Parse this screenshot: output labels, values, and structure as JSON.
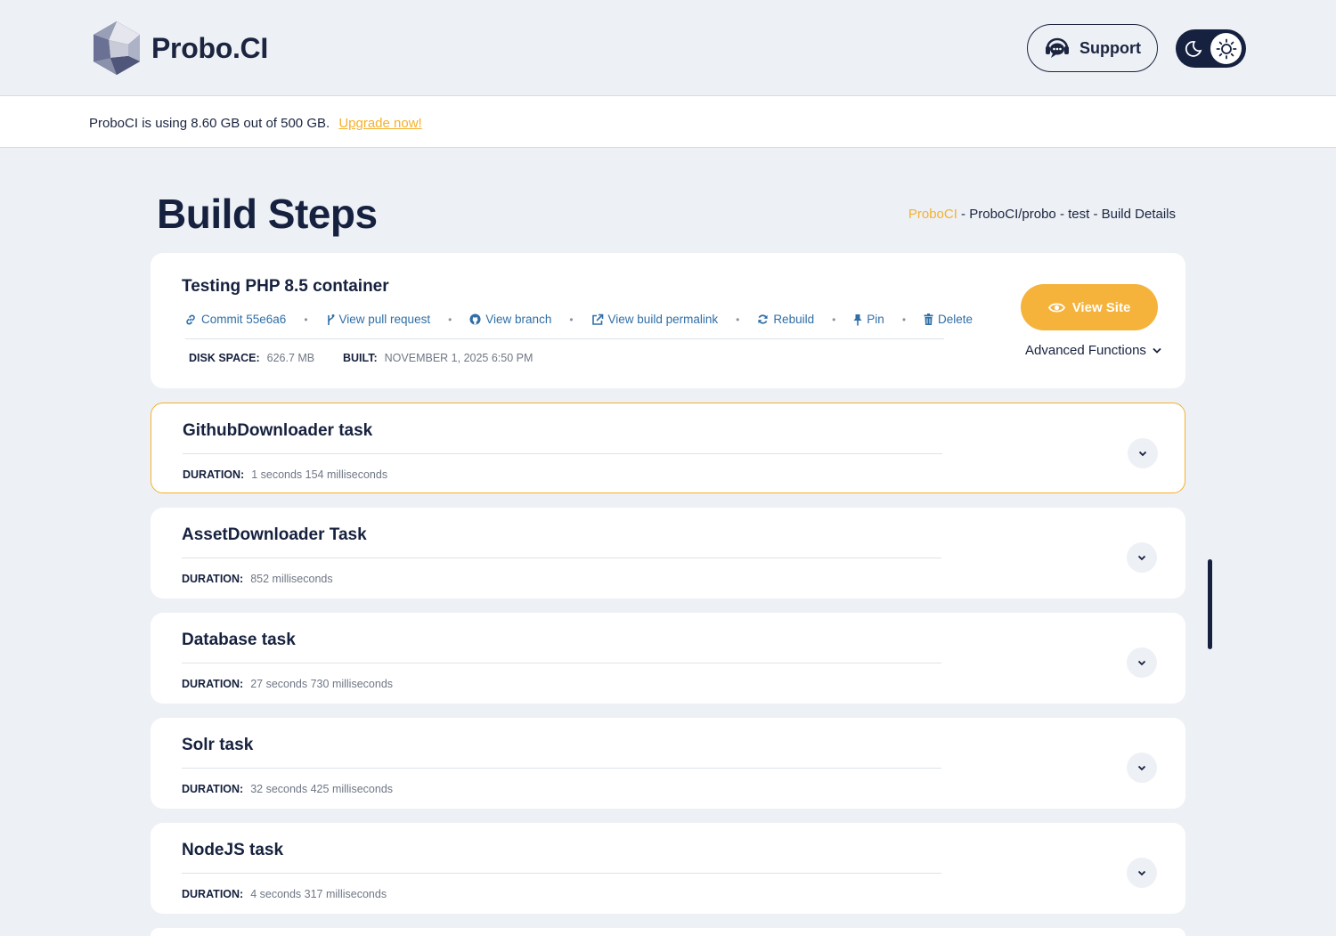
{
  "header": {
    "brand_name": "Probo.CI",
    "support_label": "Support",
    "theme_toggle": {
      "mode": "light"
    }
  },
  "storage": {
    "message": "ProboCI is using 8.60 GB out of 500 GB.",
    "upgrade_label": "Upgrade now!"
  },
  "page": {
    "title": "Build Steps",
    "breadcrumb": {
      "root": "ProboCI",
      "rest": " - ProboCI/probo - test - Build Details"
    }
  },
  "build": {
    "title": "Testing PHP 8.5 container",
    "actions": [
      {
        "label": "Commit 55e6a6",
        "icon": "link-icon"
      },
      {
        "label": "View pull request",
        "icon": "git-branch-icon"
      },
      {
        "label": "View branch",
        "icon": "github-icon"
      },
      {
        "label": "View build permalink",
        "icon": "external-link-icon"
      },
      {
        "label": "Rebuild",
        "icon": "refresh-icon"
      },
      {
        "label": "Pin",
        "icon": "pin-icon"
      },
      {
        "label": "Delete",
        "icon": "trash-icon"
      }
    ],
    "disk_space_label": "DISK SPACE:",
    "disk_space_value": "626.7 MB",
    "built_label": "BUILT:",
    "built_value": "NOVEMBER 1, 2025 6:50 PM",
    "view_site_label": "View Site",
    "advanced_label": "Advanced Functions"
  },
  "tasks": [
    {
      "name": "GithubDownloader task",
      "duration_label": "DURATION:",
      "duration": "1 seconds 154 milliseconds",
      "active": true
    },
    {
      "name": "AssetDownloader Task",
      "duration_label": "DURATION:",
      "duration": "852 milliseconds"
    },
    {
      "name": "Database task",
      "duration_label": "DURATION:",
      "duration": "27 seconds 730 milliseconds"
    },
    {
      "name": "Solr task",
      "duration_label": "DURATION:",
      "duration": "32 seconds 425 milliseconds"
    },
    {
      "name": "NodeJS task",
      "duration_label": "DURATION:",
      "duration": "4 seconds 317 milliseconds"
    }
  ],
  "colors": {
    "accent": "#f5b12c",
    "navy": "#15213f",
    "link": "#2f6ea6"
  }
}
